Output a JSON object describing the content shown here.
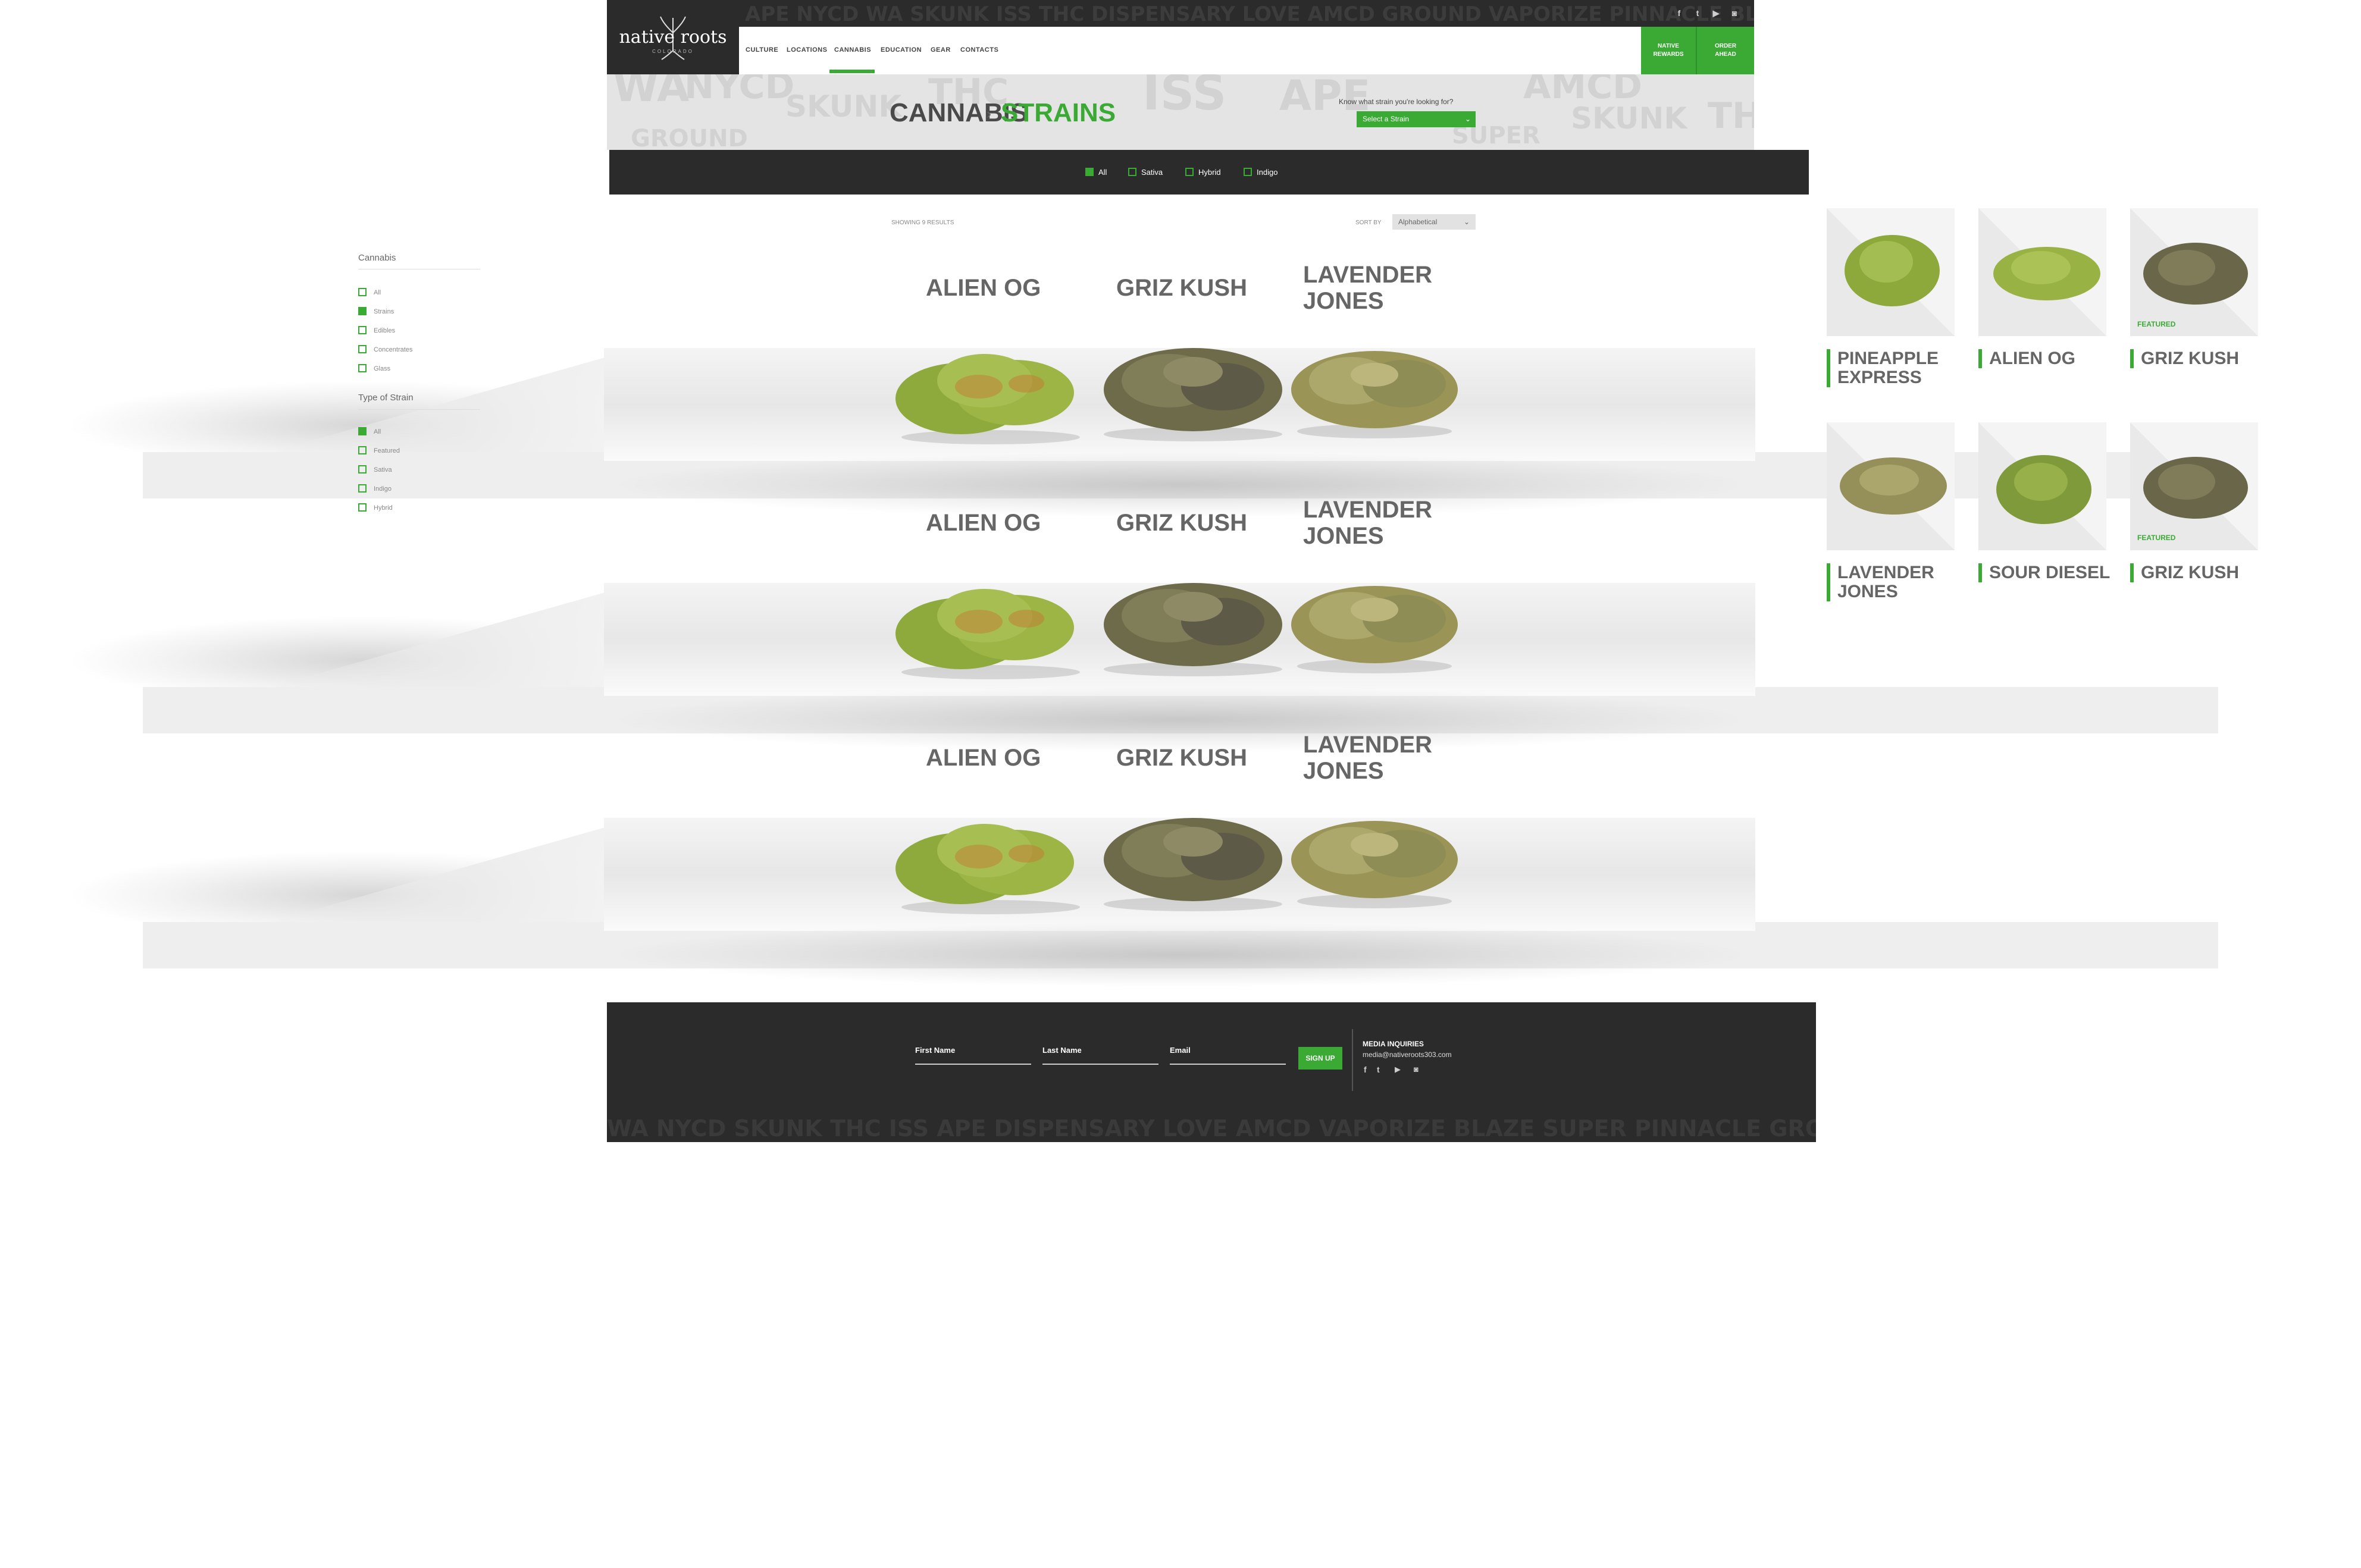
{
  "header": {
    "logo_text": "native roots",
    "logo_sub": "COLORADO",
    "nav": [
      "CULTURE",
      "LOCATIONS",
      "CANNABIS",
      "EDUCATION",
      "GEAR",
      "CONTACTS"
    ],
    "active_nav": "CANNABIS",
    "buttons": [
      {
        "line1": "NATIVE",
        "line2": "REWARDS"
      },
      {
        "line1": "ORDER",
        "line2": "AHEAD"
      }
    ],
    "social_icons": [
      "facebook-icon",
      "twitter-icon",
      "youtube-icon",
      "instagram-icon"
    ]
  },
  "page": {
    "crumb_parent": "CANNABIS",
    "crumb_sep": "›",
    "crumb_current": "STRAINS",
    "strain_prompt": "Know what strain you're looking for?",
    "strain_select": "Select a Strain"
  },
  "filters": [
    {
      "label": "All",
      "checked": true
    },
    {
      "label": "Sativa",
      "checked": false
    },
    {
      "label": "Hybrid",
      "checked": false
    },
    {
      "label": "Indigo",
      "checked": false
    }
  ],
  "results": {
    "showing": "SHOWING 9 RESULTS",
    "sort_label": "SORT BY",
    "sort_value": "Alphabetical"
  },
  "sidebar": {
    "cannabis_title": "Cannabis",
    "cannabis_items": [
      {
        "label": "All",
        "checked": false
      },
      {
        "label": "Strains",
        "checked": true
      },
      {
        "label": "Edibles",
        "checked": false
      },
      {
        "label": "Concentrates",
        "checked": false
      },
      {
        "label": "Glass",
        "checked": false
      }
    ],
    "type_title": "Type of Strain",
    "type_items": [
      {
        "label": "All",
        "checked": true
      },
      {
        "label": "Featured",
        "checked": false
      },
      {
        "label": "Sativa",
        "checked": false
      },
      {
        "label": "Indigo",
        "checked": false
      },
      {
        "label": "Hybrid",
        "checked": false
      }
    ]
  },
  "shelves": [
    {
      "strains": [
        {
          "l1": "ALIEN OG",
          "l2": ""
        },
        {
          "l1": "GRIZ KUSH",
          "l2": ""
        },
        {
          "l1": "LAVENDER",
          "l2": "JONES"
        }
      ]
    },
    {
      "strains": [
        {
          "l1": "ALIEN OG",
          "l2": ""
        },
        {
          "l1": "GRIZ KUSH",
          "l2": ""
        },
        {
          "l1": "LAVENDER",
          "l2": "JONES"
        }
      ]
    },
    {
      "strains": [
        {
          "l1": "ALIEN OG",
          "l2": ""
        },
        {
          "l1": "GRIZ KUSH",
          "l2": ""
        },
        {
          "l1": "LAVENDER",
          "l2": "JONES"
        }
      ]
    }
  ],
  "thumbs": [
    {
      "l1": "PINEAPPLE",
      "l2": "EXPRESS",
      "featured": ""
    },
    {
      "l1": "ALIEN OG",
      "l2": "",
      "featured": ""
    },
    {
      "l1": "GRIZ KUSH",
      "l2": "",
      "featured": "FEATURED"
    },
    {
      "l1": "LAVENDER",
      "l2": "JONES",
      "featured": ""
    },
    {
      "l1": "SOUR DIESEL",
      "l2": "",
      "featured": ""
    },
    {
      "l1": "GRIZ KUSH",
      "l2": "",
      "featured": "FEATURED"
    }
  ],
  "footer": {
    "first_name": "First Name",
    "last_name": "Last Name",
    "email": "Email",
    "signup": "SIGN UP",
    "media_title": "MEDIA INQUIRIES",
    "media_email": "media@nativeroots303.com"
  },
  "colors": {
    "accent": "#3aaa35",
    "dark": "#2b2b2b",
    "text": "#666666"
  }
}
